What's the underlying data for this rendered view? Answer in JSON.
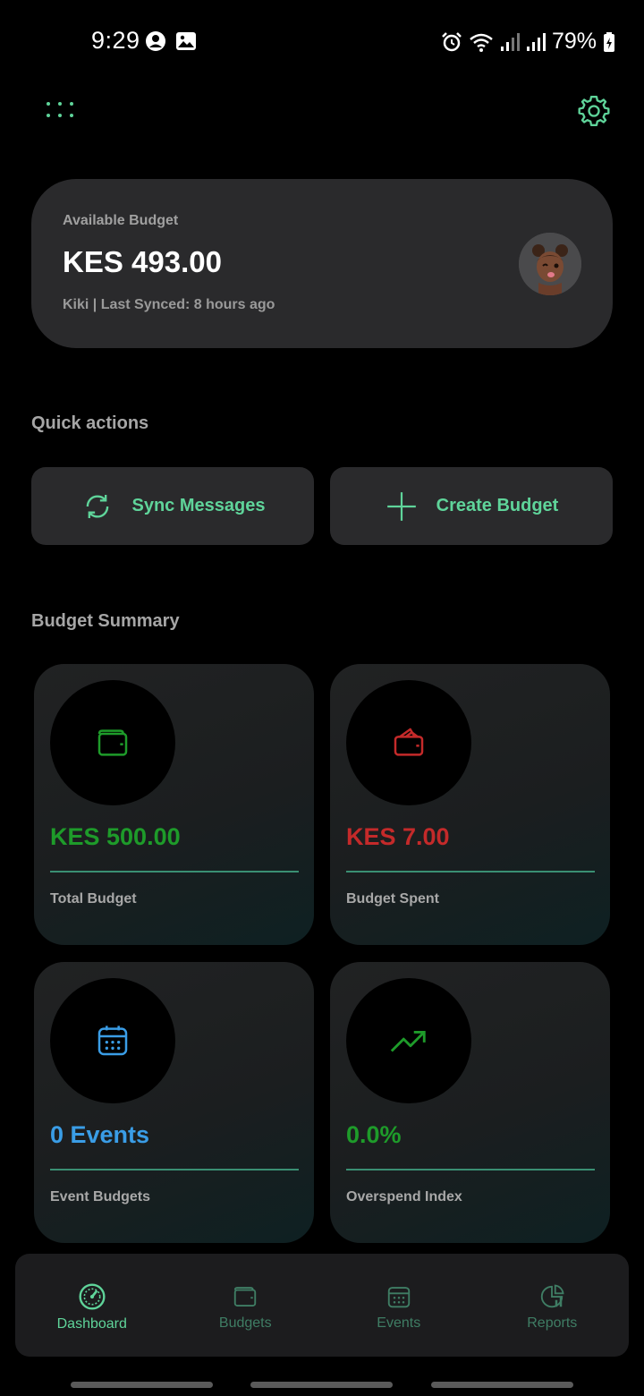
{
  "status_bar": {
    "time": "9:29",
    "battery": "79%"
  },
  "header": {
    "menu_icon": "grid-dots-icon",
    "settings_icon": "gear-icon"
  },
  "budget_card": {
    "label": "Available Budget",
    "amount": "KES 493.00",
    "meta": "Kiki | Last Synced: 8 hours ago"
  },
  "quick_actions": {
    "title": "Quick actions",
    "sync_label": "Sync Messages",
    "create_label": "Create Budget"
  },
  "summary": {
    "title": "Budget Summary",
    "cards": [
      {
        "value": "KES 500.00",
        "label": "Total Budget",
        "icon": "wallet-icon",
        "color": "#1e9b2a"
      },
      {
        "value": "KES 7.00",
        "label": "Budget Spent",
        "icon": "wallet-open-icon",
        "color": "#c42a2a"
      },
      {
        "value": "0 Events",
        "label": "Event Budgets",
        "icon": "calendar-icon",
        "color": "#3a9de6"
      },
      {
        "value": "0.0%",
        "label": "Overspend Index",
        "icon": "trending-up-icon",
        "color": "#1e9b2a"
      }
    ]
  },
  "nav": {
    "items": [
      {
        "label": "Dashboard",
        "icon": "speedometer-icon",
        "active": true
      },
      {
        "label": "Budgets",
        "icon": "wallet-icon",
        "active": false
      },
      {
        "label": "Events",
        "icon": "calendar-icon",
        "active": false
      },
      {
        "label": "Reports",
        "icon": "pie-chart-icon",
        "active": false
      }
    ]
  },
  "colors": {
    "accent": "#5fd49a",
    "background": "#000000",
    "card": "#2a2a2c"
  }
}
